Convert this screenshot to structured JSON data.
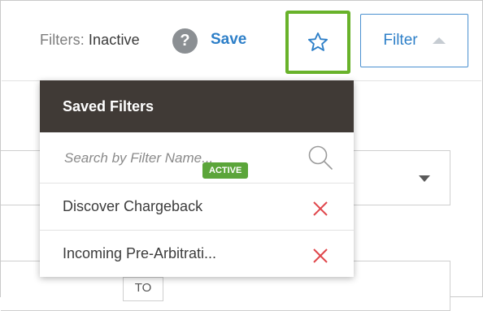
{
  "toolbar": {
    "filters_prefix": "Filters:",
    "filters_state": "Inactive",
    "help_glyph": "?",
    "save_label": "Save",
    "filter_label": "Filter",
    "accent_color": "#2d7fc8",
    "highlight_color": "#68b22a"
  },
  "background_form": {
    "to_label": "TO"
  },
  "saved_filters": {
    "title": "Saved Filters",
    "search_placeholder": "Search by Filter Name...",
    "items": [
      {
        "label": "Discover Chargeback",
        "active": false
      },
      {
        "label": "Incoming Pre-Arbitrati...",
        "active": true,
        "badge": "ACTIVE"
      }
    ]
  }
}
